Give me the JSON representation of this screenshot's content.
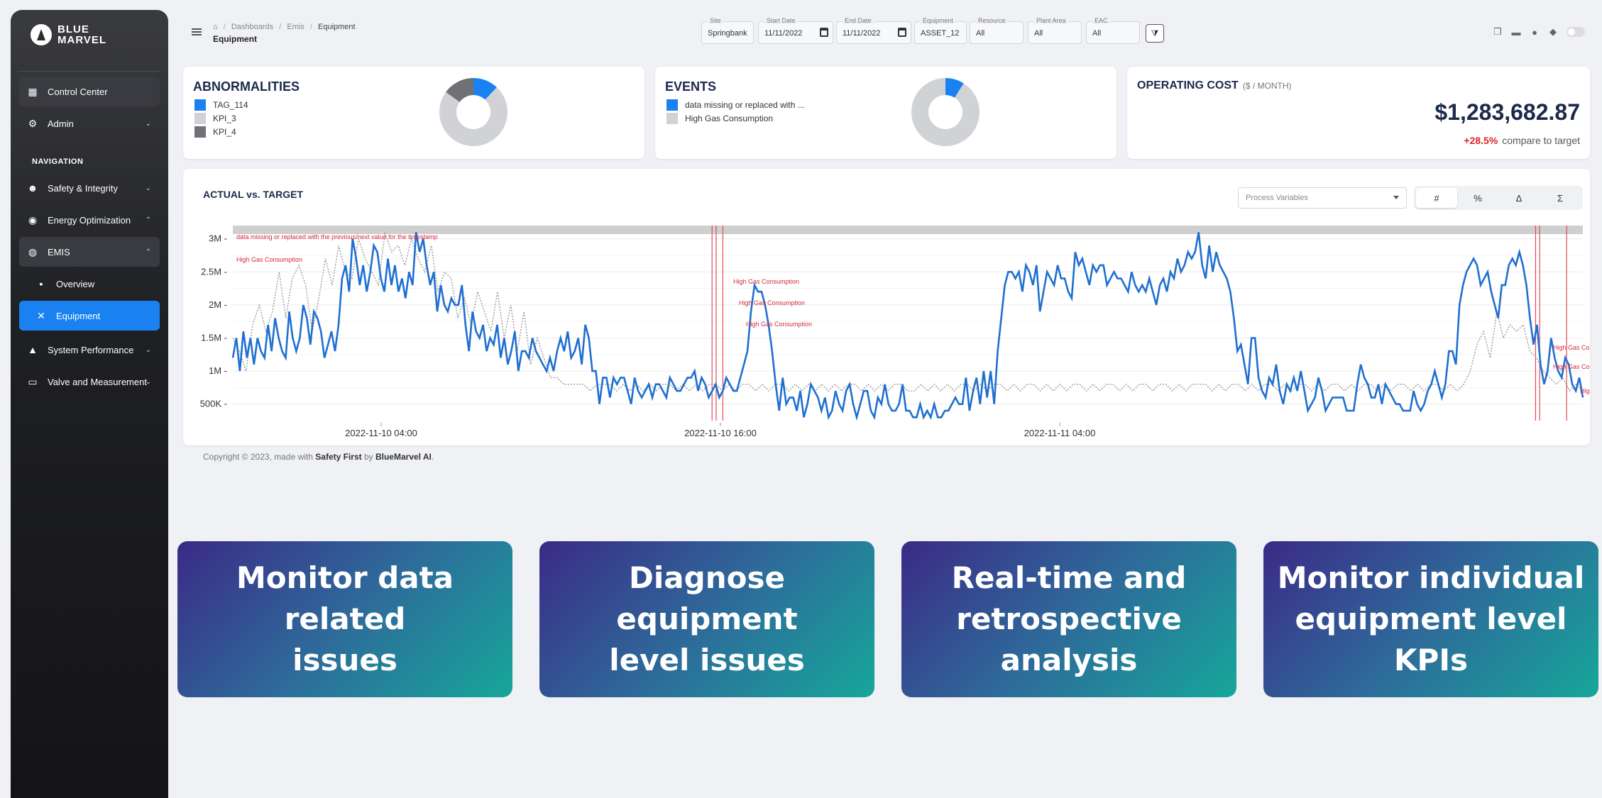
{
  "brand": {
    "line1": "BLUE",
    "line2": "MARVEL"
  },
  "sidebar": {
    "section_label": "NAVIGATION",
    "items": [
      {
        "label": "Control Center",
        "icon": "dashboard-icon"
      },
      {
        "label": "Admin",
        "icon": "user-gear-icon"
      },
      {
        "label": "Safety & Integrity",
        "icon": "people-icon"
      },
      {
        "label": "Energy Optimization",
        "icon": "energy-icon"
      },
      {
        "label": "EMIS",
        "icon": "emis-icon"
      },
      {
        "label": "Overview",
        "icon": "grid-icon"
      },
      {
        "label": "Equipment",
        "icon": "tools-icon"
      },
      {
        "label": "System Performance",
        "icon": "rocket-icon"
      },
      {
        "label": "Valve and Measurement",
        "icon": "ruler-icon"
      }
    ]
  },
  "header": {
    "breadcrumbs": [
      "Dashboards",
      "Emis",
      "Equipment"
    ],
    "title": "Equipment",
    "filters": [
      {
        "label": "Site",
        "value": "Springbank"
      },
      {
        "label": "Start Date",
        "value": "11/11/2022"
      },
      {
        "label": "End Date",
        "value": "11/11/2022"
      },
      {
        "label": "Equipment",
        "value": "ASSET_12"
      },
      {
        "label": "Resource",
        "value": "All"
      },
      {
        "label": "Plant Area",
        "value": "All"
      },
      {
        "label": "EAC",
        "value": "All"
      }
    ]
  },
  "abnormalities": {
    "title": "ABNORMALITIES",
    "legend": [
      {
        "label": "TAG_114",
        "color": "#1a82f0"
      },
      {
        "label": "KPI_3",
        "color": "#d0d2d6"
      },
      {
        "label": "KPI_4",
        "color": "#6f7175"
      }
    ]
  },
  "events": {
    "title": "EVENTS",
    "legend": [
      {
        "label": "data missing or replaced with ...",
        "color": "#1a82f0"
      },
      {
        "label": "High Gas Consumption",
        "color": "#d0d2d6"
      }
    ]
  },
  "operating_cost": {
    "title": "OPERATING COST",
    "unit": "($ / MONTH)",
    "value": "$1,283,682.87",
    "delta": "+28.5%",
    "compare": "compare to target"
  },
  "chart": {
    "title": "ACTUAL vs. TARGET",
    "select_placeholder": "Process Variables",
    "modes": [
      "#",
      "%",
      "Δ",
      "Σ"
    ]
  },
  "chart_data": {
    "type": "line",
    "title": "ACTUAL vs. TARGET",
    "y_ticks": [
      "3M",
      "2.5M",
      "2M",
      "1.5M",
      "1M",
      "500K"
    ],
    "ylim": [
      250000,
      3200000
    ],
    "x_ticks": [
      "2022-11-10 04:00",
      "2022-11-10 16:00",
      "2022-11-11 04:00"
    ],
    "annotations": [
      "data missing or replaced with the previous/next value for the timestamp",
      "High Gas Consumption",
      "High Gas Consumption",
      "High Gas Consumption",
      "High Gas Consumption",
      "High Gas Consumption",
      "High Gas Consumption",
      "High"
    ],
    "series": [
      {
        "color": "#1f6fd1",
        "values": [
          1200000,
          1500000,
          1000000,
          1600000,
          1200000,
          1500000,
          1100000,
          1500000,
          1300000,
          1200000,
          1700000,
          1300000,
          1800000,
          1500000,
          1300000,
          1200000,
          1900000,
          1500000,
          1300000,
          1500000,
          2000000,
          1800000,
          1400000,
          1900000,
          1800000,
          1600000,
          1200000,
          1400000,
          1600000,
          1300000,
          1700000,
          2400000,
          2600000,
          2200000,
          3000000,
          2700000,
          2300000,
          2600000,
          2200000,
          2500000,
          2900000,
          2800000,
          2400000,
          2200000,
          2700000,
          2300000,
          2600000,
          2200000,
          2400000,
          2100000,
          2500000,
          2300000,
          3100000,
          2800000,
          3000000,
          2600000,
          2300000,
          2500000,
          1900000,
          2300000,
          2000000,
          1900000,
          2100000,
          2000000,
          2000000,
          2300000,
          1700000,
          1300000,
          1900000,
          1600000,
          1500000,
          1700000,
          1300000,
          1500000,
          1400000,
          1700000,
          1200000,
          1500000,
          1100000,
          1300000,
          1600000,
          1000000,
          1300000,
          1300000,
          1200000,
          1500000,
          1300000,
          1200000,
          1100000,
          1000000,
          1200000,
          1000000,
          1300000,
          1500000,
          1300000,
          1600000,
          1200000,
          1300000,
          1500000,
          1100000,
          1700000,
          1500000,
          1000000,
          1000000,
          500000,
          900000,
          900000,
          600000,
          900000,
          800000,
          900000,
          900000,
          700000,
          500000,
          900000,
          700000,
          600000,
          700000,
          800000,
          600000,
          800000,
          800000,
          700000,
          600000,
          900000,
          800000,
          700000,
          700000,
          800000,
          900000,
          900000,
          1000000,
          700000,
          900000,
          800000,
          600000,
          700000,
          800000,
          600000,
          700000,
          900000,
          800000,
          700000,
          700000,
          900000,
          1100000,
          1300000,
          1900000,
          2300000,
          2200000,
          2200000,
          2000000,
          1700000,
          1300000,
          800000,
          400000,
          900000,
          500000,
          600000,
          600000,
          400000,
          700000,
          300000,
          500000,
          800000,
          700000,
          600000,
          400000,
          600000,
          300000,
          400000,
          700000,
          500000,
          400000,
          700000,
          800000,
          500000,
          300000,
          500000,
          700000,
          700000,
          400000,
          300000,
          600000,
          500000,
          800000,
          500000,
          400000,
          400000,
          500000,
          800000,
          400000,
          400000,
          300000,
          300000,
          500000,
          300000,
          400000,
          300000,
          500000,
          300000,
          300000,
          400000,
          400000,
          500000,
          600000,
          500000,
          500000,
          900000,
          400000,
          700000,
          900000,
          500000,
          1000000,
          600000,
          1000000,
          500000,
          1300000,
          1800000,
          2300000,
          2500000,
          2500000,
          2400000,
          2500000,
          2200000,
          2600000,
          2500000,
          2300000,
          2600000,
          1900000,
          2200000,
          2500000,
          2400000,
          2300000,
          2600000,
          2400000,
          2400000,
          2200000,
          2100000,
          2800000,
          2600000,
          2700000,
          2500000,
          2300000,
          2600000,
          2500000,
          2600000,
          2600000,
          2300000,
          2400000,
          2500000,
          2400000,
          2400000,
          2300000,
          2200000,
          2500000,
          2300000,
          2200000,
          2300000,
          2200000,
          2400000,
          2200000,
          2000000,
          2300000,
          2400000,
          2200000,
          2500000,
          2400000,
          2700000,
          2500000,
          2600000,
          2800000,
          2700000,
          2800000,
          3100000,
          2600000,
          2400000,
          2900000,
          2500000,
          2800000,
          2600000,
          2500000,
          2400000,
          2200000,
          1800000,
          1300000,
          1400000,
          1100000,
          800000,
          1500000,
          1500000,
          900000,
          700000,
          600000,
          900000,
          800000,
          1100000,
          700000,
          500000,
          800000,
          700000,
          900000,
          700000,
          1000000,
          700000,
          400000,
          500000,
          600000,
          900000,
          700000,
          400000,
          500000,
          600000,
          600000,
          600000,
          600000,
          400000,
          400000,
          400000,
          800000,
          1100000,
          900000,
          800000,
          600000,
          600000,
          800000,
          500000,
          800000,
          700000,
          600000,
          500000,
          500000,
          400000,
          400000,
          400000,
          700000,
          500000,
          400000,
          500000,
          700000,
          800000,
          1000000,
          800000,
          600000,
          800000,
          1300000,
          1300000,
          1100000,
          2000000,
          2300000,
          2500000,
          2600000,
          2700000,
          2600000,
          2300000,
          2400000,
          2500000,
          2200000,
          2000000,
          1800000,
          2300000,
          2300000,
          2600000,
          2700000,
          2600000,
          2800000,
          2600000,
          2300000,
          1800000,
          1400000,
          1700000,
          1100000,
          800000,
          1000000,
          1500000,
          1200000,
          1000000,
          900000,
          1200000,
          1100000,
          800000,
          700000,
          900000,
          600000
        ]
      },
      {
        "color": "#9a9a9a",
        "values": [
          1500000,
          1300000,
          1000000,
          1700000,
          2000000,
          1600000,
          1900000,
          2500000,
          1800000,
          2400000,
          2600000,
          2300000,
          1600000,
          2100000,
          2700000,
          2300000,
          2900000,
          2500000,
          2400000,
          3000000,
          2700000,
          2500000,
          2300000,
          3100000,
          2800000,
          2900000,
          2600000,
          3000000,
          2700000,
          2500000,
          2900000,
          2200000,
          2500000,
          2400000,
          1800000,
          2100000,
          1700000,
          2200000,
          1900000,
          1600000,
          2200000,
          1500000,
          2000000,
          1300000,
          1900000,
          1100000,
          1500000,
          1200000,
          900000,
          900000,
          800000,
          800000,
          800000,
          800000,
          700000,
          800000,
          800000,
          800000,
          700000,
          800000,
          700000,
          800000,
          700000,
          800000,
          700000,
          800000,
          800000,
          700000,
          800000,
          700000,
          800000,
          700000,
          800000,
          800000,
          700000,
          800000,
          700000,
          800000,
          800000,
          700000,
          800000,
          700000,
          800000,
          800000,
          700000,
          800000,
          700000,
          800000,
          700000,
          800000,
          700000,
          800000,
          700000,
          800000,
          800000,
          700000,
          800000,
          700000,
          800000,
          700000,
          800000,
          800000,
          700000,
          700000,
          800000,
          700000,
          800000,
          700000,
          800000,
          700000,
          800000,
          800000,
          700000,
          800000,
          700000,
          800000,
          800000,
          700000,
          800000,
          700000,
          800000,
          800000,
          700000,
          800000,
          700000,
          800000,
          700000,
          800000,
          800000,
          700000,
          800000,
          700000,
          800000,
          800000,
          700000,
          800000,
          700000,
          800000,
          800000,
          700000,
          800000,
          800000,
          700000,
          800000,
          700000,
          800000,
          800000,
          800000,
          700000,
          800000,
          700000,
          800000,
          800000,
          700000,
          800000,
          700000,
          800000,
          800000,
          700000,
          800000,
          700000,
          800000,
          800000,
          700000,
          800000,
          700000,
          800000,
          800000,
          700000,
          800000,
          700000,
          800000,
          800000,
          700000,
          800000,
          700000,
          800000,
          800000,
          700000,
          800000,
          700000,
          800000,
          800000,
          700000,
          800000,
          700000,
          800000,
          1000000,
          1400000,
          1600000,
          1200000,
          1900000,
          1500000,
          1700000,
          1600000,
          1700000,
          1300000,
          1200000,
          1000000,
          900000,
          800000,
          900000,
          700000,
          800000,
          700000
        ]
      }
    ],
    "event_markers": [
      0.355,
      0.358,
      0.363,
      0.965,
      0.968,
      0.988
    ],
    "grid": true
  },
  "footer": {
    "prefix": "Copyright © 2023, made with ",
    "safety": "Safety First",
    "by": " by ",
    "company": "BlueMarvel AI",
    "suffix": "."
  },
  "tiles": [
    {
      "line1": "Monitor data related",
      "line2": "issues"
    },
    {
      "line1": "Diagnose equipment",
      "line2": "level issues"
    },
    {
      "line1": "Real-time and",
      "line2": "retrospective analysis"
    },
    {
      "line1": "Monitor individual",
      "line2": "equipment level KPIs"
    }
  ]
}
